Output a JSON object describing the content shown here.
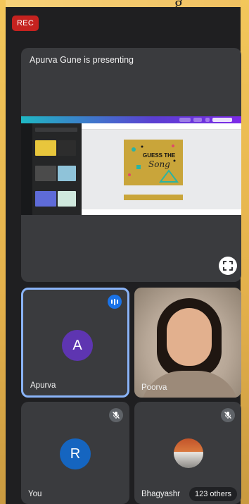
{
  "top_text": "g",
  "rec_label": "REC",
  "presentation": {
    "title": "Apurva Gune is presenting",
    "slide_text_1": "GUESS THE",
    "slide_text_2": "Song"
  },
  "tiles": [
    {
      "name": "Apurva",
      "initial": "A",
      "avatar_color": "#5e35b1",
      "speaking": true
    },
    {
      "name": "Poorva",
      "video": true
    },
    {
      "name": "You",
      "initial": "R",
      "avatar_color": "#1565c0",
      "muted": true
    },
    {
      "name": "Bhagyashr",
      "muted": true,
      "others": "123 others"
    }
  ],
  "colors": {
    "rec": "#c5221f",
    "active_border": "#8ab4f8",
    "speaking": "#1a73e8",
    "tile_bg": "#3a3b3e",
    "page_bg": "#1f1f21"
  },
  "icons": [
    "fullscreen-icon",
    "speaking-indicator-icon",
    "mic-off-icon"
  ]
}
